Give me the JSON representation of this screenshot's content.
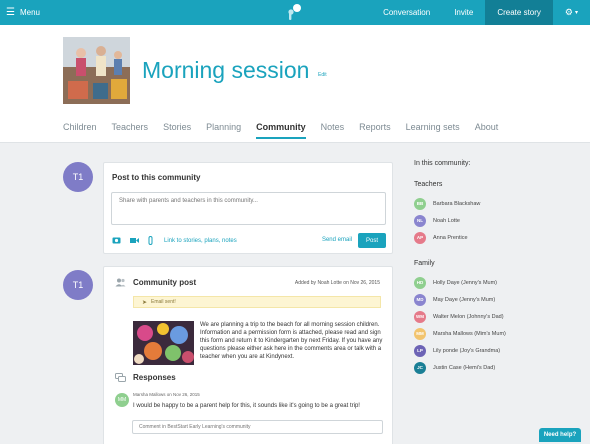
{
  "topbar": {
    "menu_label": "Menu",
    "nav": [
      {
        "label": "Conversation"
      },
      {
        "label": "Invite"
      },
      {
        "label": "Create story"
      }
    ],
    "colors": {
      "bar": "#1aa3bd",
      "create": "#127f96"
    }
  },
  "header": {
    "title": "Morning session",
    "edit_label": "Edit",
    "tabs": [
      "Children",
      "Teachers",
      "Stories",
      "Planning",
      "Community",
      "Notes",
      "Reports",
      "Learning sets",
      "About"
    ],
    "active_tab": "Community"
  },
  "composer": {
    "avatar_initials": "T1",
    "title": "Post to this community",
    "placeholder": "Share with parents and teachers in this community...",
    "link_text": "Link to stories, plans, notes",
    "send_email": "Send email",
    "post_button": "Post"
  },
  "community_post": {
    "avatar_initials": "T1",
    "title": "Community post",
    "added_by": "Added by Noah Lotte on Nov 26, 2015",
    "email_sent": "Email sent!",
    "body": "We are planning a trip to the beach for all morning session children. Information and a permission form is attached, please read and sign this form and return it to Kindergarten by next Friday. If you have any questions please either ask here in the comments area or talk with a teacher when you are at Kindynext.",
    "responses_title": "Responses",
    "response": {
      "initials": "MM",
      "meta": "Marsha Mallows on Nov 26, 2015",
      "text": "I would be happy to be a parent help for this, it sounds like it's going to be a great trip!"
    },
    "comment_placeholder": "Comment in BestStart Early Learning's community"
  },
  "sidebar": {
    "heading": "In this community:",
    "teachers_label": "Teachers",
    "teachers": [
      {
        "initials": "BB",
        "name": "Barbara Blackshaw",
        "color": "#8fcf8f"
      },
      {
        "initials": "NL",
        "name": "Noah Lotte",
        "color": "#8a85cf"
      },
      {
        "initials": "AP",
        "name": "Anna Prentice",
        "color": "#e57a8a"
      }
    ],
    "family_label": "Family",
    "family": [
      {
        "initials": "HD",
        "name": "Holly Daye (Jenny's Mum)",
        "color": "#8fcf8f"
      },
      {
        "initials": "MD",
        "name": "May Daye (Jenny's Mum)",
        "color": "#8a85cf"
      },
      {
        "initials": "WM",
        "name": "Walter Melon (Johnny's Dad)",
        "color": "#e57a8a"
      },
      {
        "initials": "MM",
        "name": "Marsha Mallows (Mim's Mum)",
        "color": "#f2c46e"
      },
      {
        "initials": "LP",
        "name": "Lily ponde (Joy's Grandma)",
        "color": "#6c63b5"
      },
      {
        "initials": "JC",
        "name": "Justin Case (Hemi's Dad)",
        "color": "#1a7f96"
      }
    ]
  },
  "help_label": "Need help?"
}
